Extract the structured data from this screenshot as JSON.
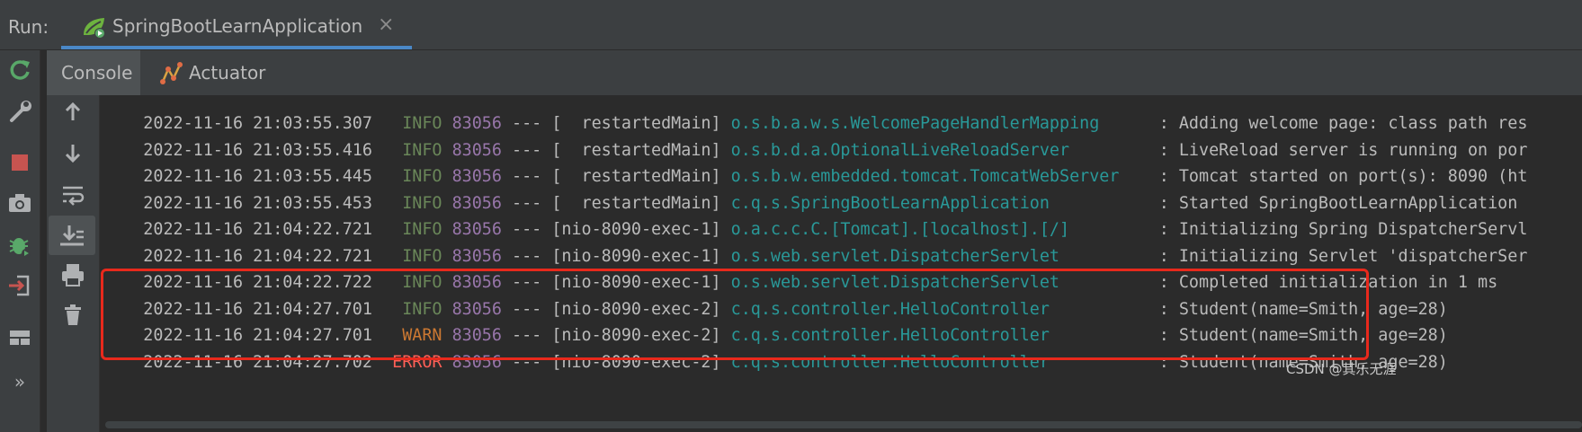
{
  "run_bar": {
    "label": "Run:",
    "tab_title": "SpringBootLearnApplication",
    "tab_icon": "spring-boot-run-icon",
    "close_glyph": "×"
  },
  "sub_tabs": [
    {
      "label": "Console",
      "active": true
    },
    {
      "label": "Actuator",
      "active": false,
      "icon": "actuator-icon"
    }
  ],
  "sidebar_left": [
    "rerun-icon",
    "wrench-icon",
    "stop-icon",
    "camera-icon",
    "debug-bug-icon",
    "login-icon",
    "layout-icon",
    "more-icon"
  ],
  "more_glyph": "»",
  "sidebar_right": [
    "scroll-up-icon",
    "scroll-down-icon",
    "soft-wrap-icon",
    "scroll-to-end-icon",
    "print-icon",
    "trash-icon"
  ],
  "log_lines": [
    {
      "date": "2022-11-16 21:03:55.307",
      "level": "INFO",
      "pid": "83056",
      "sep": "---",
      "thread": "[  restartedMain]",
      "logger": "o.s.b.a.w.s.WelcomePageHandlerMapping",
      "message": ": Adding welcome page: class path res"
    },
    {
      "date": "2022-11-16 21:03:55.416",
      "level": "INFO",
      "pid": "83056",
      "sep": "---",
      "thread": "[  restartedMain]",
      "logger": "o.s.b.d.a.OptionalLiveReloadServer",
      "message": ": LiveReload server is running on por"
    },
    {
      "date": "2022-11-16 21:03:55.445",
      "level": "INFO",
      "pid": "83056",
      "sep": "---",
      "thread": "[  restartedMain]",
      "logger": "o.s.b.w.embedded.tomcat.TomcatWebServer",
      "message": ": Tomcat started on port(s): 8090 (ht"
    },
    {
      "date": "2022-11-16 21:03:55.453",
      "level": "INFO",
      "pid": "83056",
      "sep": "---",
      "thread": "[  restartedMain]",
      "logger": "c.q.s.SpringBootLearnApplication",
      "message": ": Started SpringBootLearnApplication "
    },
    {
      "date": "2022-11-16 21:04:22.721",
      "level": "INFO",
      "pid": "83056",
      "sep": "---",
      "thread": "[nio-8090-exec-1]",
      "logger": "o.a.c.c.C.[Tomcat].[localhost].[/]",
      "message": ": Initializing Spring DispatcherServl"
    },
    {
      "date": "2022-11-16 21:04:22.721",
      "level": "INFO",
      "pid": "83056",
      "sep": "---",
      "thread": "[nio-8090-exec-1]",
      "logger": "o.s.web.servlet.DispatcherServlet",
      "message": ": Initializing Servlet 'dispatcherSer"
    },
    {
      "date": "2022-11-16 21:04:22.722",
      "level": "INFO",
      "pid": "83056",
      "sep": "---",
      "thread": "[nio-8090-exec-1]",
      "logger": "o.s.web.servlet.DispatcherServlet",
      "message": ": Completed initialization in 1 ms"
    },
    {
      "date": "2022-11-16 21:04:27.701",
      "level": "INFO",
      "pid": "83056",
      "sep": "---",
      "thread": "[nio-8090-exec-2]",
      "logger": "c.q.s.controller.HelloController",
      "message": ": Student(name=Smith, age=28)"
    },
    {
      "date": "2022-11-16 21:04:27.701",
      "level": "WARN",
      "pid": "83056",
      "sep": "---",
      "thread": "[nio-8090-exec-2]",
      "logger": "c.q.s.controller.HelloController",
      "message": ": Student(name=Smith, age=28)"
    },
    {
      "date": "2022-11-16 21:04:27.702",
      "level": "ERROR",
      "pid": "83056",
      "sep": "---",
      "thread": "[nio-8090-exec-2]",
      "logger": "c.q.s.controller.HelloController",
      "message": ": Student(name=Smith, age=28)"
    }
  ],
  "watermark": "CSDN @其乐无涯",
  "colors": {
    "info": "#6a8759",
    "warn": "#cc7832",
    "error": "#ff5f56",
    "pid": "#9876aa",
    "logger": "#299999",
    "highlight_box": "#e8291c",
    "tab_underline": "#4a88c7"
  }
}
